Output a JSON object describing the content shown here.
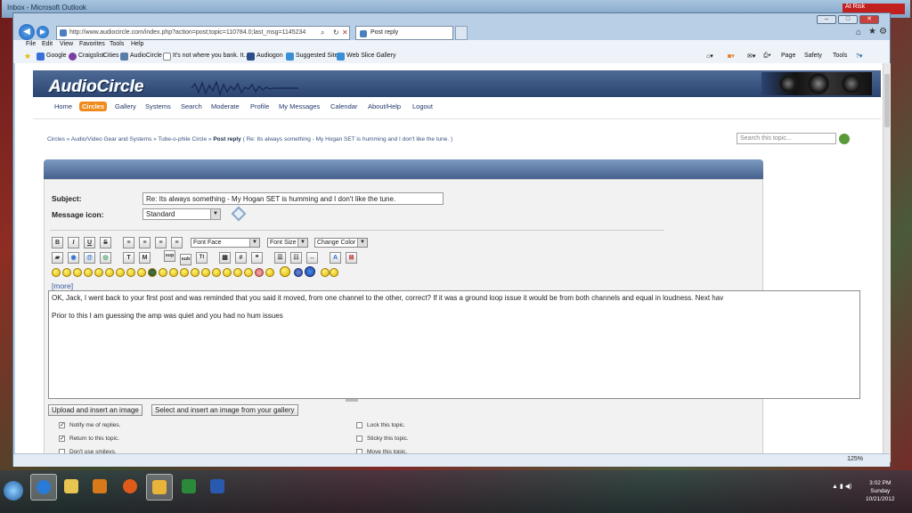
{
  "desktop": {
    "background_window_title": "Inbox - Microsoft Outlook",
    "at_risk_badge": "At Risk"
  },
  "browser": {
    "address_url": "http://www.audiocircle.com/index.php?action=post;topic=110784.0;last_msg=1145234",
    "tab_title": "Post reply",
    "menu": [
      "File",
      "Edit",
      "View",
      "Favorites",
      "Tools",
      "Help"
    ],
    "favorites": [
      "Google",
      "Craigslist",
      "Cities",
      "AudioCircle",
      "It's not where you bank. It...",
      "Audiogon",
      "Suggested Sites",
      "Web Slice Gallery"
    ],
    "command_bar": [
      "Page",
      "Safety",
      "Tools"
    ],
    "zoom": "125%"
  },
  "site": {
    "logo": "AudioCircle",
    "nav": [
      "Home",
      "Circles",
      "Gallery",
      "Systems",
      "Search",
      "Moderate",
      "Profile",
      "My Messages",
      "Calendar",
      "About/Help",
      "Logout"
    ],
    "active_nav": "Circles",
    "breadcrumb": {
      "items": [
        "Circles",
        "Audio/Video Gear and Systems",
        "Tube-o-phile Circle"
      ],
      "current": "Post reply",
      "topic_paren": "( Re: Its always something - My Hogan SET is humming and I don't like the tune. )"
    },
    "search_placeholder": "Search this topic..."
  },
  "form": {
    "subject_label": "Subject:",
    "subject_value": "Re: Its always something - My Hogan SET is humming and I don't like the tune.",
    "icon_label": "Message icon:",
    "icon_value": "Standard",
    "toolbar": {
      "bold": "B",
      "italic": "I",
      "underline": "U",
      "strike": "S",
      "font_face": "Font Face",
      "font_size": "Font Size",
      "change_color": "Change Color",
      "superscript": "sup",
      "subscript": "sub",
      "teletype": "Tt",
      "more_smileys": "[more]"
    },
    "message_line1": "OK, Jack, I went back to your first post and was reminded that you said it moved, from one channel to the other, correct?  If it was a ground loop issue it would be from both channels and equal in loudness.  Next hav",
    "message_line2": "Prior to this I am guessing the amp was quiet and you had no hum issues",
    "upload_button": "Upload and insert an image",
    "gallery_button": "Select and insert an image from your gallery",
    "options": [
      {
        "label": "Notify me of replies.",
        "checked": true
      },
      {
        "label": "Return to this topic.",
        "checked": true
      },
      {
        "label": "Don't use smileys.",
        "checked": false
      },
      {
        "label": "Lock this topic.",
        "checked": false
      },
      {
        "label": "Sticky this topic.",
        "checked": false
      },
      {
        "label": "Move this topic.",
        "checked": false
      }
    ]
  },
  "taskbar": {
    "time": "3:02 PM",
    "day": "Sunday",
    "date": "10/21/2012"
  }
}
